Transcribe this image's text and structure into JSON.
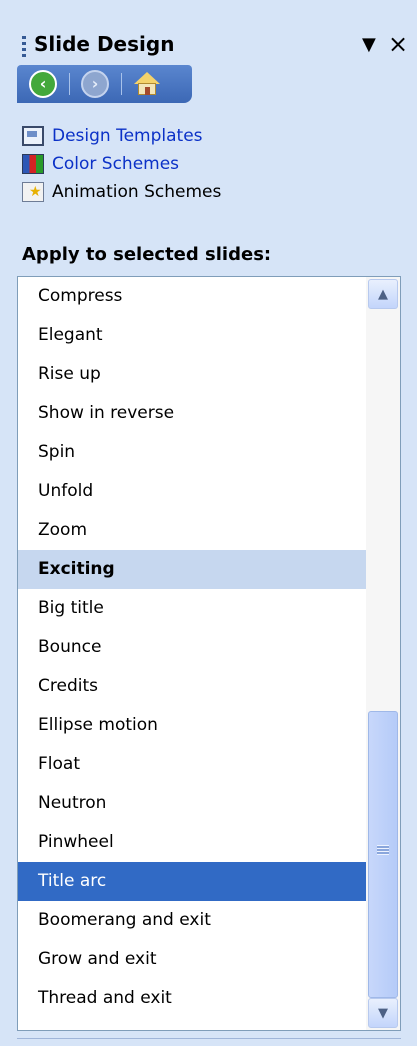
{
  "header": {
    "title": "Slide Design",
    "menu_icon": "dropdown-arrow",
    "close_icon": "close-x"
  },
  "navbar": {
    "back_icon": "back-arrow-icon",
    "forward_icon": "forward-arrow-icon",
    "home_icon": "home-icon"
  },
  "links": [
    {
      "label": "Design Templates",
      "icon": "design-templates-icon",
      "color": "#0b31c7"
    },
    {
      "label": "Color Schemes",
      "icon": "color-schemes-icon",
      "color": "#0b31c7"
    },
    {
      "label": "Animation Schemes",
      "icon": "animation-schemes-icon",
      "color": "#000000"
    }
  ],
  "apply_label": "Apply to selected slides:",
  "list": {
    "items": [
      {
        "label": "Compress",
        "type": "item"
      },
      {
        "label": "Elegant",
        "type": "item"
      },
      {
        "label": "Rise up",
        "type": "item"
      },
      {
        "label": "Show in reverse",
        "type": "item"
      },
      {
        "label": "Spin",
        "type": "item"
      },
      {
        "label": "Unfold",
        "type": "item"
      },
      {
        "label": "Zoom",
        "type": "item"
      },
      {
        "label": "Exciting",
        "type": "heading"
      },
      {
        "label": "Big title",
        "type": "item"
      },
      {
        "label": "Bounce",
        "type": "item"
      },
      {
        "label": "Credits",
        "type": "item"
      },
      {
        "label": "Ellipse motion",
        "type": "item"
      },
      {
        "label": "Float",
        "type": "item"
      },
      {
        "label": "Neutron",
        "type": "item"
      },
      {
        "label": "Pinwheel",
        "type": "item"
      },
      {
        "label": "Title arc",
        "type": "selected"
      },
      {
        "label": "Boomerang and exit",
        "type": "item"
      },
      {
        "label": "Grow and exit",
        "type": "item"
      },
      {
        "label": "Thread and exit",
        "type": "item"
      }
    ],
    "selected": "Title arc"
  },
  "colors": {
    "pane_bg": "#d6e4f7",
    "selection": "#316ac5",
    "heading_bg": "#c6d7ef",
    "link": "#0b31c7"
  }
}
